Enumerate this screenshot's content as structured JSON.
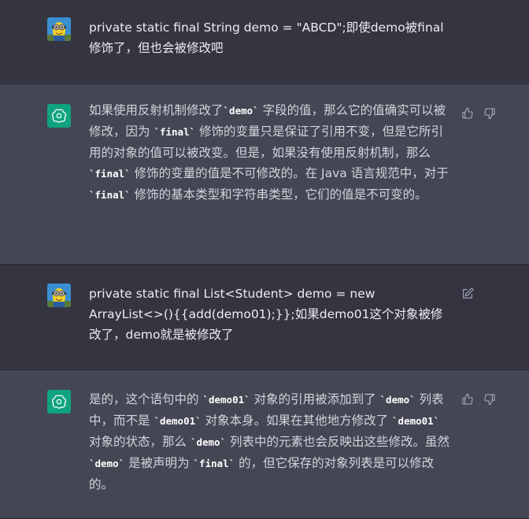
{
  "conversation": [
    {
      "role": "user",
      "avatar_icon": "minion-avatar-icon",
      "segments": [
        {
          "t": "private static final String demo = \"ABCD\";即使demo被final修饰了，但也会被修改吧"
        }
      ]
    },
    {
      "role": "assistant",
      "avatar_icon": "openai-logo-icon",
      "segments": [
        {
          "t": "如果使用反射机制修改了"
        },
        {
          "c": "`demo`"
        },
        {
          "t": " 字段的值，那么它的值确实可以被修改，因为 "
        },
        {
          "c": "`final`"
        },
        {
          "t": " 修饰的变量只是保证了引用不变，但是它所引用的对象的值可以被改变。但是，如果没有使用反射机制，那么 "
        },
        {
          "c": "`final`"
        },
        {
          "t": " 修饰的变量的值是不可修改的。在 Java 语言规范中，对于 "
        },
        {
          "c": "`final`"
        },
        {
          "t": " 修饰的基本类型和字符串类型，它们的值是不可变的。"
        }
      ]
    },
    {
      "role": "user",
      "avatar_icon": "minion-avatar-icon",
      "segments": [
        {
          "t": "private static final List<Student> demo = new ArrayList<>(){{add(demo01);}};如果demo01这个对象被修改了，demo就是被修改了"
        }
      ]
    },
    {
      "role": "assistant",
      "avatar_icon": "openai-logo-icon",
      "segments": [
        {
          "t": "是的，这个语句中的 "
        },
        {
          "c": "`demo01`"
        },
        {
          "t": " 对象的引用被添加到了 "
        },
        {
          "c": "`demo`"
        },
        {
          "t": " 列表中，而不是 "
        },
        {
          "c": "`demo01`"
        },
        {
          "t": " 对象本身。如果在其他地方修改了 "
        },
        {
          "c": "`demo01`"
        },
        {
          "t": " 对象的状态，那么 "
        },
        {
          "c": "`demo`"
        },
        {
          "t": " 列表中的元素也会反映出这些修改。虽然 "
        },
        {
          "c": "`demo`"
        },
        {
          "t": " 是被声明为 "
        },
        {
          "c": "`final`"
        },
        {
          "t": " 的，但它保存的对象列表是可以修改的。"
        }
      ]
    }
  ],
  "icons": {
    "thumbs_up": "thumbs-up-icon",
    "thumbs_down": "thumbs-down-icon",
    "edit": "edit-icon"
  },
  "colors": {
    "user_bg": "#343541",
    "assistant_bg": "#444654",
    "openai_green": "#10a37f"
  }
}
